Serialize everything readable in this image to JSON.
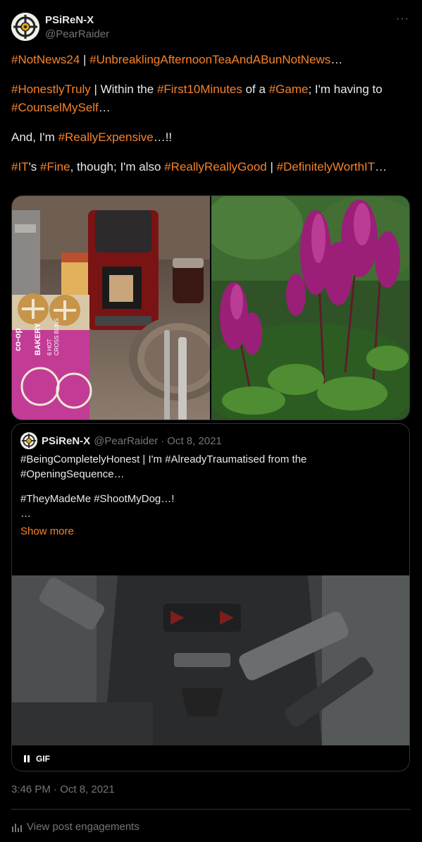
{
  "post": {
    "author_name": "PSiReN-X",
    "author_handle": "@PearRaider",
    "more_label": "···",
    "lines": [
      [
        {
          "t": "#NotNews24",
          "tag": true
        },
        {
          "t": " | ",
          "tag": false
        },
        {
          "t": "#UnbreaklingAfternoonTeaAndABunNotNews",
          "tag": true
        },
        {
          "t": "…",
          "tag": false
        }
      ],
      [
        {
          "t": "#HonestlyTruly",
          "tag": true
        },
        {
          "t": " | Within the ",
          "tag": false
        },
        {
          "t": "#First10Minutes",
          "tag": true
        },
        {
          "t": " of a ",
          "tag": false
        },
        {
          "t": "#Game",
          "tag": true
        },
        {
          "t": "; I'm having to",
          "tag": false
        }
      ],
      [
        {
          "t": "#CounselMySelf",
          "tag": true
        },
        {
          "t": "…",
          "tag": false
        }
      ],
      [
        {
          "t": "And, I'm ",
          "tag": false
        },
        {
          "t": "#ReallyExpensive",
          "tag": true
        },
        {
          "t": "…!!",
          "tag": false
        }
      ],
      [
        {
          "t": "#IT",
          "tag": true
        },
        {
          "t": "'s ",
          "tag": false
        },
        {
          "t": "#Fine",
          "tag": true
        },
        {
          "t": ", though; I'm also ",
          "tag": false
        },
        {
          "t": "#ReallyReallyGood",
          "tag": true
        },
        {
          "t": " | ",
          "tag": false
        },
        {
          "t": "#DefinitelyWorthIT",
          "tag": true
        },
        {
          "t": "…",
          "tag": false
        }
      ]
    ],
    "photo_labels": [
      "co-op",
      "BAKERY",
      "6 HOT",
      "CROSS BUNS"
    ],
    "timestamp": "3:46 PM · Oct 8, 2021",
    "engagements_label": "View post engagements"
  },
  "quote": {
    "author_name": "PSiReN-X",
    "author_handle": "@PearRaider",
    "separator": "·",
    "date": "Oct 8, 2021",
    "lines": [
      "#BeingCompletelyHonest | I'm #AlreadyTraumatised from the",
      "#OpeningSequence…",
      "",
      "#TheyMadeMe #ShootMyDog…!",
      "…"
    ],
    "show_more": "Show more",
    "gif_label": "GIF"
  },
  "colors": {
    "accent": "#f7822a",
    "text": "#e7e9ea",
    "muted": "#71767b",
    "border": "#2f3336",
    "background": "#000000"
  },
  "icons": [
    "pause-icon",
    "engagement-chart-icon",
    "more-icon",
    "avatar-crosshair-icon"
  ]
}
